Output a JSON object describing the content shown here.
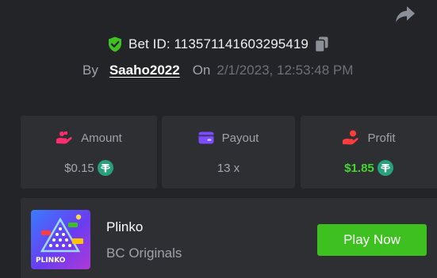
{
  "colors": {
    "background": "#232427",
    "card": "#2d2f33",
    "shield": "#3ec020",
    "amount_icon": "#ff2d6e",
    "payout_icon": "#7b4dff",
    "profit_icon": "#ff3b3b",
    "profit_value": "#44d62c",
    "coin": "#26a17b",
    "play_button": "#3ec020"
  },
  "header": {
    "share_icon": "share-arrow-icon",
    "bet_id_label": "Bet ID: 113571141603295419",
    "shield_icon": "shield-check-icon",
    "copy_icon": "copy-icon",
    "by_label": "By",
    "username": "Saaho2022",
    "on_label": "On",
    "timestamp": "2/1/2023, 12:53:48 PM"
  },
  "stats": {
    "amount": {
      "label": "Amount",
      "value": "$0.15",
      "icon": "amount-icon",
      "currency_icon": "tether-icon"
    },
    "payout": {
      "label": "Payout",
      "value": "13 x",
      "icon": "wallet-icon"
    },
    "profit": {
      "label": "Profit",
      "value": "$1.85",
      "icon": "profit-hand-icon",
      "currency_icon": "tether-icon"
    }
  },
  "game": {
    "name": "Plinko",
    "provider": "BC Originals",
    "thumbnail_text": "PLINKO",
    "thumbnail_icon": "plinko-thumbnail",
    "play_label": "Play Now"
  }
}
